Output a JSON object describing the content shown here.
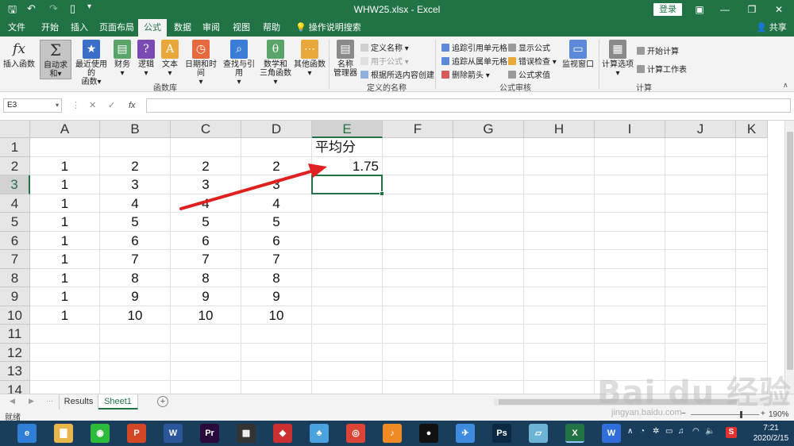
{
  "app": {
    "file_title": "WHW25.xlsx",
    "app_name": "Excel",
    "title_sep": "-",
    "login_label": "登录",
    "share_label": "共享"
  },
  "tabs": [
    "文件",
    "开始",
    "插入",
    "页面布局",
    "公式",
    "数据",
    "审阅",
    "视图",
    "帮助"
  ],
  "active_tab": "公式",
  "help_search": "操作说明搜索",
  "ribbon": {
    "function_library": {
      "group_label": "函数库",
      "buttons": [
        {
          "label": "插入函数",
          "icon": "fx-icon",
          "glyph": "fx"
        },
        {
          "label": "自动求和",
          "icon": "sigma-icon",
          "glyph": "Σ",
          "selected": true,
          "dropdown": "▾"
        },
        {
          "label": "最近使用的",
          "label2": "函数",
          "icon": "star-icon",
          "glyph": "★",
          "dropdown": "▾"
        },
        {
          "label": "财务",
          "icon": "finance-icon",
          "glyph": "▤",
          "dropdown": "▾"
        },
        {
          "label": "逻辑",
          "icon": "logic-icon",
          "glyph": "?",
          "dropdown": "▾"
        },
        {
          "label": "文本",
          "icon": "text-icon",
          "glyph": "A",
          "dropdown": "▾"
        },
        {
          "label": "日期和时间",
          "icon": "calendar-icon",
          "glyph": "◷",
          "dropdown": "▾"
        },
        {
          "label": "查找与引用",
          "icon": "lookup-icon",
          "glyph": "⌕",
          "dropdown": "▾"
        },
        {
          "label": "数学和",
          "label2": "三角函数",
          "icon": "math-icon",
          "glyph": "θ",
          "dropdown": "▾"
        },
        {
          "label": "其他函数",
          "icon": "more-functions-icon",
          "glyph": "⋯",
          "dropdown": "▾"
        }
      ]
    },
    "defined_names": {
      "group_label": "定义的名称",
      "name_manager": "名称",
      "name_manager2": "管理器",
      "define_name": "定义名称",
      "use_in_formula": "用于公式",
      "create_from_selection": "根据所选内容创建"
    },
    "formula_auditing": {
      "group_label": "公式审核",
      "trace_precedents": "追踪引用单元格",
      "trace_dependents": "追踪从属单元格",
      "remove_arrows": "删除箭头",
      "show_formulas": "显示公式",
      "error_checking": "错误检查",
      "evaluate_formula": "公式求值",
      "watch_window": "监视窗口"
    },
    "calculation": {
      "group_label": "计算",
      "calc_options": "计算选项",
      "calc_now": "开始计算",
      "calc_sheet": "计算工作表"
    }
  },
  "formula_bar": {
    "name_box": "E3",
    "cancel_glyph": "✕",
    "enter_glyph": "✓",
    "fx_glyph": "fx",
    "formula": ""
  },
  "grid": {
    "columns": [
      "A",
      "B",
      "C",
      "D",
      "E",
      "F",
      "G",
      "H",
      "I",
      "J",
      "K"
    ],
    "rows": [
      "1",
      "2",
      "3",
      "4",
      "5",
      "6",
      "7",
      "8",
      "9",
      "10",
      "11",
      "12",
      "13",
      "14"
    ],
    "selected_cell": "E3",
    "cells": {
      "E1": "平均分",
      "A2": "1",
      "B2": "2",
      "C2": "2",
      "D2": "2",
      "E2": "1.75",
      "A3": "1",
      "B3": "3",
      "C3": "3",
      "D3": "3",
      "A4": "1",
      "B4": "4",
      "C4": "4",
      "D4": "4",
      "A5": "1",
      "B5": "5",
      "C5": "5",
      "D5": "5",
      "A6": "1",
      "B6": "6",
      "C6": "6",
      "D6": "6",
      "A7": "1",
      "B7": "7",
      "C7": "7",
      "D7": "7",
      "A8": "1",
      "B8": "8",
      "C8": "8",
      "D8": "8",
      "A9": "1",
      "B9": "9",
      "C9": "9",
      "D9": "9",
      "A10": "1",
      "B10": "10",
      "C10": "10",
      "D10": "10"
    }
  },
  "sheets": [
    "Results",
    "Sheet1"
  ],
  "active_sheet": "Sheet1",
  "status": {
    "ready": "就绪",
    "zoom": "190%",
    "zoom_minus": "−",
    "zoom_plus": "+"
  },
  "taskbar": {
    "apps": [
      {
        "name": "browser-icon",
        "glyph": "e",
        "color": "#2f7fd6"
      },
      {
        "name": "file-explorer-icon",
        "glyph": "▇",
        "color": "#e8b64a"
      },
      {
        "name": "wechat-icon",
        "glyph": "◉",
        "color": "#2dbb3c"
      },
      {
        "name": "powerpoint-icon",
        "glyph": "P",
        "color": "#d24726"
      },
      {
        "name": "word-icon",
        "glyph": "W",
        "color": "#2b579a"
      },
      {
        "name": "premiere-icon",
        "glyph": "Pr",
        "color": "#2a0a3a"
      },
      {
        "name": "video-editor-icon",
        "glyph": "▦",
        "color": "#333333"
      },
      {
        "name": "media-player-icon",
        "glyph": "◆",
        "color": "#cc2f2f"
      },
      {
        "name": "game-icon",
        "glyph": "♣",
        "color": "#4aa3df"
      },
      {
        "name": "chrome-icon",
        "glyph": "◎",
        "color": "#db4437"
      },
      {
        "name": "music-icon",
        "glyph": "♪",
        "color": "#f08a24"
      },
      {
        "name": "qq-icon",
        "glyph": "●",
        "color": "#111111"
      },
      {
        "name": "feishu-icon",
        "glyph": "✈",
        "color": "#3f8be0"
      },
      {
        "name": "photoshop-icon",
        "glyph": "Ps",
        "color": "#0b2942"
      },
      {
        "name": "notes-icon",
        "glyph": "▱",
        "color": "#6db3d6"
      },
      {
        "name": "excel-icon",
        "glyph": "X",
        "color": "#217346",
        "active": true
      },
      {
        "name": "wps-icon",
        "glyph": "W",
        "color": "#2f6edb"
      }
    ],
    "tray_ime": "S",
    "time": "7:21",
    "date": "2020/2/15"
  },
  "watermark": {
    "text": "Bai du 经验",
    "sub": "jingyan.baidu.com"
  }
}
